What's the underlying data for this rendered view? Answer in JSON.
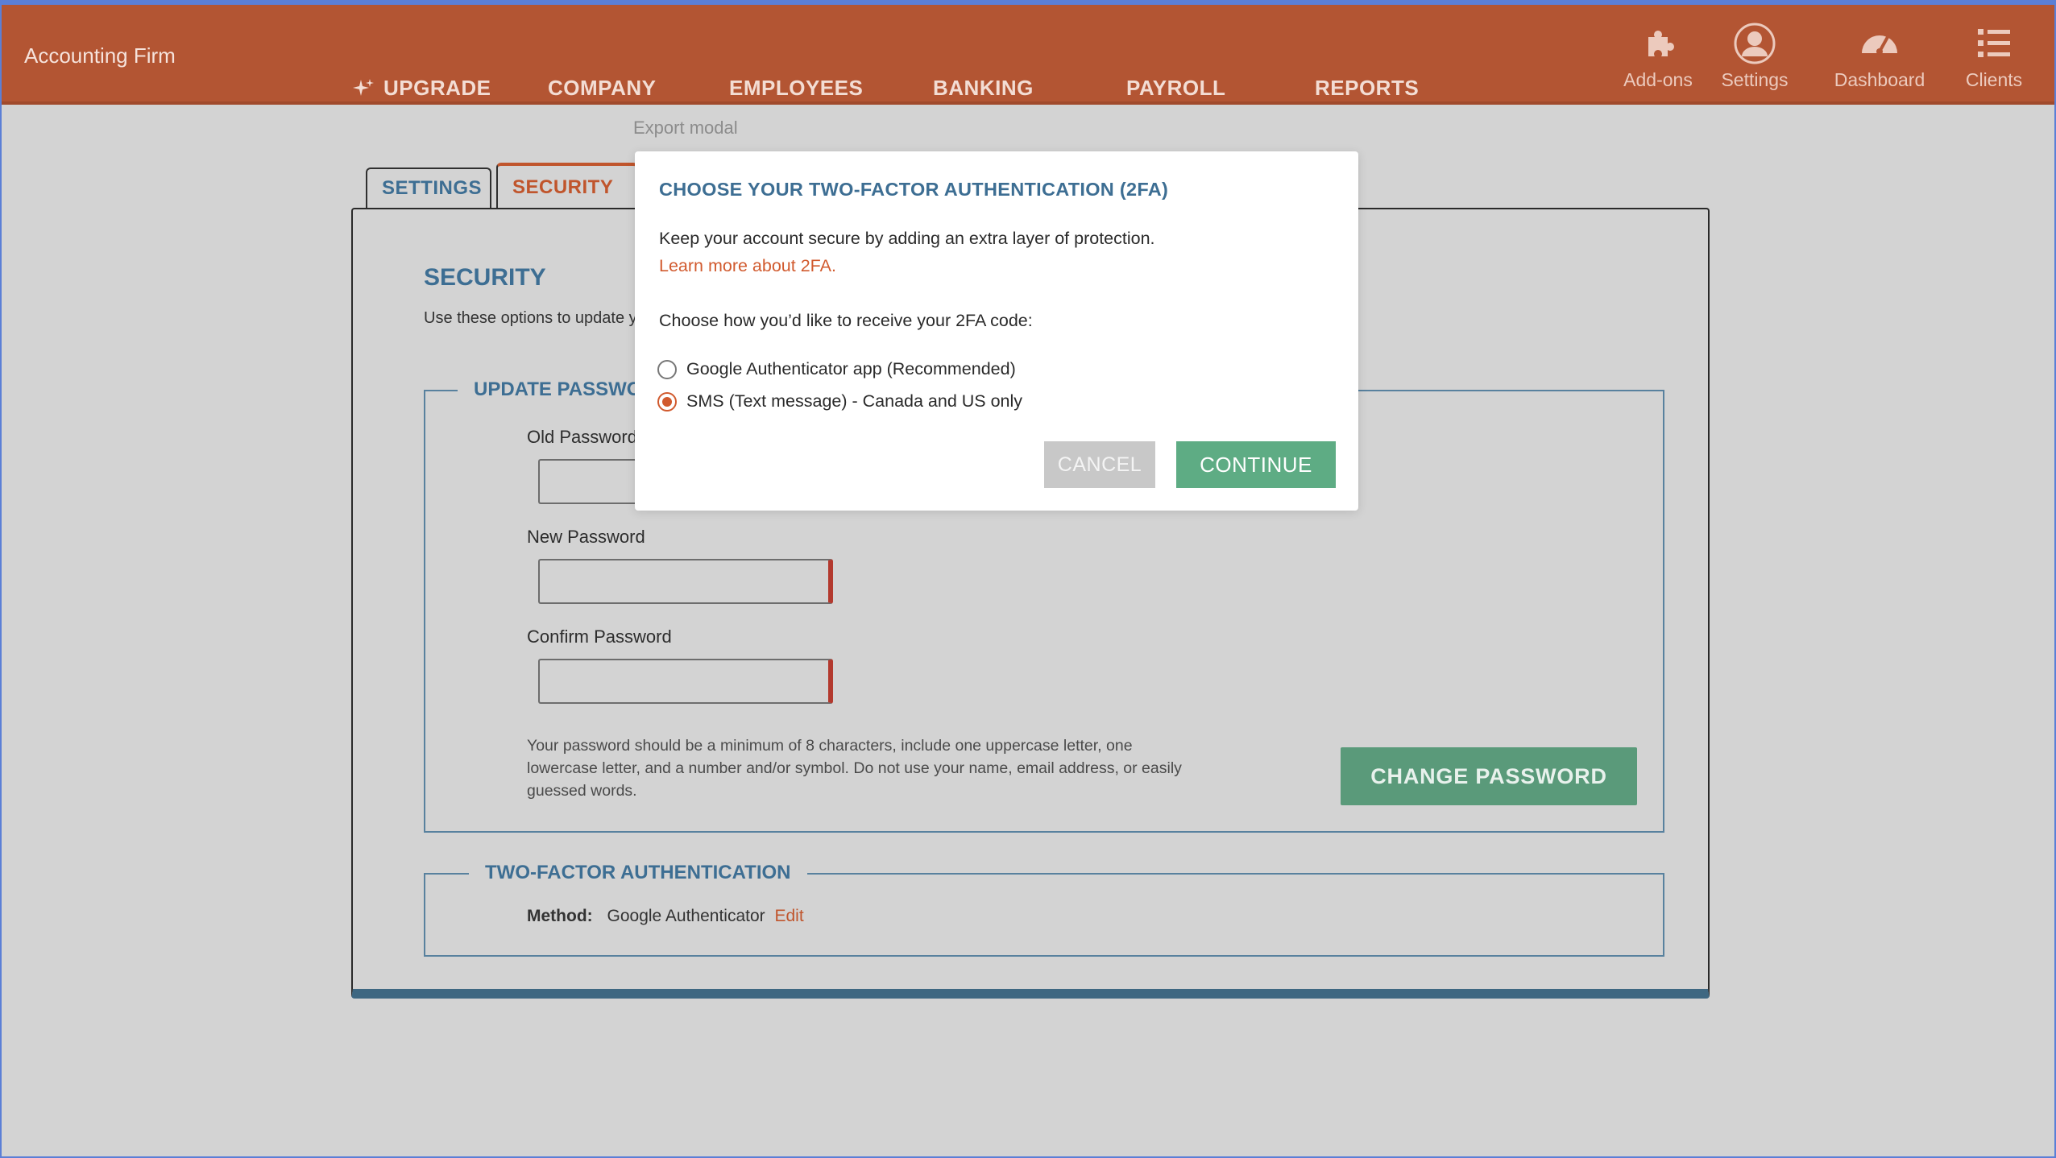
{
  "app": {
    "brand": "Accounting Firm"
  },
  "nav": {
    "upgrade": "UPGRADE",
    "company": "COMPANY",
    "employees": "EMPLOYEES",
    "banking": "BANKING",
    "payroll": "PAYROLL",
    "reports": "REPORTS"
  },
  "top_icons": {
    "addons": "Add-ons",
    "settings": "Settings",
    "dashboard": "Dashboard",
    "clients": "Clients"
  },
  "export_label": "Export modal",
  "tabs": {
    "settings": "SETTINGS",
    "security": "SECURITY"
  },
  "panel": {
    "title": "SECURITY",
    "description": "Use these options to update y"
  },
  "password_section": {
    "legend": "UPDATE PASSWORD",
    "old_label": "Old Password",
    "new_label": "New Password",
    "confirm_label": "Confirm Password",
    "hint": "Your password should be a minimum of 8 characters, include one uppercase letter, one lowercase letter, and a number and/or symbol. Do not use your name, email address, or easily guessed words.",
    "change_button": "CHANGE PASSWORD"
  },
  "twofa_section": {
    "legend": "TWO-FACTOR AUTHENTICATION",
    "method_label": "Method:",
    "method_value": "Google Authenticator",
    "edit_link": "Edit"
  },
  "modal": {
    "title": "CHOOSE YOUR TWO-FACTOR AUTHENTICATION (2FA)",
    "text": "Keep your account secure by adding an extra layer of protection.",
    "link": "Learn more about 2FA.",
    "prompt": "Choose how you’d like to receive your 2FA code:",
    "options": [
      {
        "label": "Google Authenticator app (Recommended)",
        "selected": false
      },
      {
        "label": "SMS (Text message) - Canada and US only",
        "selected": true
      }
    ],
    "cancel": "CANCEL",
    "continue": "CONTINUE"
  },
  "colors": {
    "topbar": "#b35533",
    "accent_blue": "#3d6e93",
    "accent_orange": "#d15a2e",
    "green_button": "#5eac84"
  }
}
